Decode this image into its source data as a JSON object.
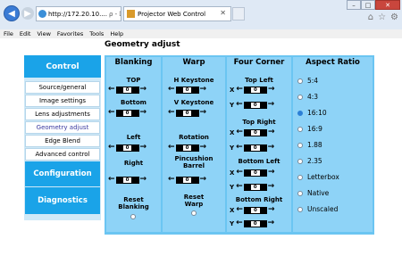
{
  "browser": {
    "address": "http://172.20.10....",
    "address_tools": "ρ - ⌧ ↻ ✕",
    "tab_title": "Projector Web Control",
    "menu": [
      "File",
      "Edit",
      "View",
      "Favorites",
      "Tools",
      "Help"
    ]
  },
  "page": {
    "title": "Geometry adjust"
  },
  "sidebar": {
    "header": "Control",
    "items": [
      "Source/general",
      "Image settings",
      "Lens adjustments",
      "Geometry adjust",
      "Edge Blend",
      "Advanced control"
    ],
    "active_index": 3,
    "section_configuration": "Configuration",
    "section_diagnostics": "Diagnostics"
  },
  "blanking": {
    "title": "Blanking",
    "top": {
      "label": "TOP",
      "value": "0"
    },
    "bottom": {
      "label": "Bottom",
      "value": "0"
    },
    "left": {
      "label": "Left",
      "value": "0"
    },
    "right": {
      "label": "Right",
      "value": "0"
    },
    "reset": "Reset Blanking"
  },
  "warp": {
    "title": "Warp",
    "h_keystone": {
      "label": "H Keystone",
      "value": "0"
    },
    "v_keystone": {
      "label": "V Keystone",
      "value": "0"
    },
    "rotation": {
      "label": "Rotation",
      "value": "0"
    },
    "pincushion": {
      "label": "Pincushion Barrel",
      "value": "0"
    },
    "reset": "Reset Warp"
  },
  "four_corner": {
    "title": "Four Corner",
    "top_left": {
      "label": "Top Left",
      "x": "0",
      "y": "0"
    },
    "top_right": {
      "label": "Top Right",
      "x": "0",
      "y": "0"
    },
    "bottom_left": {
      "label": "Bottom Left",
      "x": "0",
      "y": "0"
    },
    "bottom_right": {
      "label": "Bottom Right",
      "x": "0",
      "y": "0"
    },
    "x_label": "X",
    "y_label": "Y"
  },
  "aspect_ratio": {
    "title": "Aspect Ratio",
    "options": [
      "5:4",
      "4:3",
      "16:10",
      "16:9",
      "1.88",
      "2.35",
      "Letterbox",
      "Native",
      "Unscaled"
    ],
    "selected": "16:10"
  },
  "colors": {
    "accent": "#1aa3e8",
    "panel": "#6bc5f2",
    "column": "#8ed3f7",
    "sidebar_bg": "#cfe9f8"
  },
  "icons": {
    "left_arrow": "left-arrow-icon",
    "right_arrow": "right-arrow-icon"
  }
}
